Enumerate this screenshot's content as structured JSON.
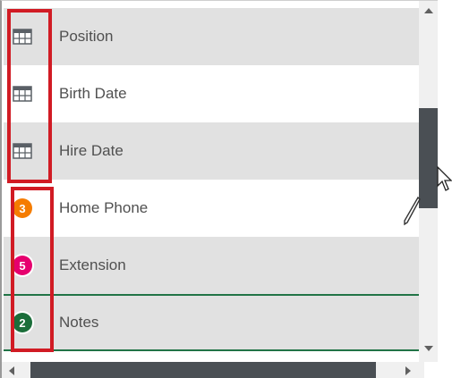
{
  "rows": [
    {
      "label": "Position",
      "icon": "table-icon",
      "style": "alt"
    },
    {
      "label": "Birth Date",
      "icon": "table-icon",
      "style": "white"
    },
    {
      "label": "Hire Date",
      "icon": "table-icon",
      "style": "alt"
    },
    {
      "label": "Home Phone",
      "icon": "badge-3-icon",
      "badge": "3",
      "badge_color": "#f57c00",
      "style": "white"
    },
    {
      "label": "Extension",
      "icon": "badge-5-icon",
      "badge": "5",
      "badge_color": "#e6006e",
      "style": "alt"
    },
    {
      "label": "Notes",
      "icon": "badge-2-icon",
      "badge": "2",
      "badge_color": "#1b6e3a",
      "style": "alt"
    }
  ],
  "colors": {
    "highlight_box": "#d11b24",
    "selected_row_border": "#217346",
    "scroll_thumb": "#4a4f54"
  }
}
